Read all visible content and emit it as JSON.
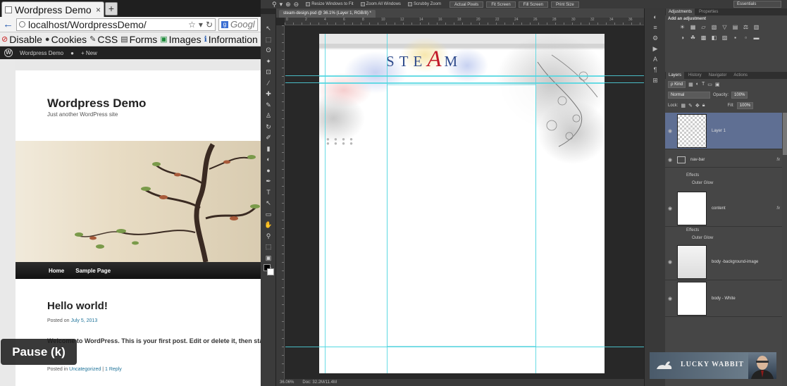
{
  "browser": {
    "tab_title": "Wordpress Demo | J...",
    "tab_close": "×",
    "new_tab": "+",
    "url": "localhost/WordpressDemo/",
    "search_placeholder": "Googl",
    "dev_toolbar": [
      {
        "icon": "disable-icon",
        "glyph": "⊘",
        "color_class": "ic-red",
        "label": "Disable"
      },
      {
        "icon": "cookies-icon",
        "glyph": "●",
        "color_class": "ic-dark",
        "label": "Cookies"
      },
      {
        "icon": "css-icon",
        "glyph": "✎",
        "color_class": "ic-dark",
        "label": "CSS"
      },
      {
        "icon": "forms-icon",
        "glyph": "▤",
        "color_class": "ic-dark",
        "label": "Forms"
      },
      {
        "icon": "images-icon",
        "glyph": "▣",
        "color_class": "ic-green",
        "label": "Images"
      },
      {
        "icon": "information-icon",
        "glyph": "ℹ",
        "color_class": "ic-blue",
        "label": "Information"
      }
    ],
    "admin_bar": {
      "site_name": "Wordpress Demo",
      "new_label": "+ New",
      "wp_letter": "W",
      "comment_glyph": "●"
    }
  },
  "wordpress": {
    "site_title": "Wordpress Demo",
    "tagline": "Just another WordPress site",
    "nav": [
      "Home",
      "Sample Page"
    ],
    "post_title": "Hello world!",
    "posted_on_prefix": "Posted on ",
    "post_date": "July 5, 2013",
    "post_excerpt": "Welcome to WordPress. This is your first post. Edit or delete it, then sta",
    "posted_in_prefix": "Posted in ",
    "category": "Uncategorized",
    "separator": " | ",
    "replies": "1 Reply"
  },
  "overlay": {
    "pause_label": "Pause (k)"
  },
  "photoshop": {
    "options": {
      "tool_glyphs": [
        "⚲",
        "▾",
        "⊕",
        "⊖"
      ],
      "checkboxes": [
        "Resize Windows to Fit",
        "Zoom All Windows",
        "Scrubby Zoom"
      ],
      "buttons": [
        "Actual Pixels",
        "Fit Screen",
        "Fill Screen",
        "Print Size"
      ],
      "workspace": "Essentials"
    },
    "document_tab": "steam-design.psd @ 36.1% (Layer 1, RGB/8) *",
    "ruler_labels": [
      "0",
      "2",
      "4",
      "6",
      "8",
      "10",
      "12",
      "14",
      "16",
      "18",
      "20",
      "22",
      "24",
      "26",
      "28",
      "30",
      "32",
      "34",
      "36"
    ],
    "tools": [
      "↖",
      "⬚",
      "ʘ",
      "✦",
      "⊡",
      "⁄",
      "✚",
      "✎",
      "♙",
      "↻",
      "✐",
      "▮",
      "◐",
      "●",
      "✒",
      "T",
      "↖",
      "▭",
      "✋",
      "⚲",
      "⬚",
      "▣",
      "▢"
    ],
    "logo_text_before": "STE",
    "logo_big_letter": "A",
    "logo_text_after": "M",
    "dots": "● ● ● ●\n● ● ● ●",
    "cursor_glyph": "⚲",
    "status": {
      "zoom": "36.06%",
      "doc_size": "Doc: 32.2M/11.4M"
    },
    "panel_icons": [
      "◐",
      "≡",
      "⚙",
      "▶",
      "A",
      "¶",
      "⊞"
    ],
    "adjustments": {
      "tabs": [
        "Adjustments",
        "Properties"
      ],
      "title": "Add an adjustment",
      "icons": [
        "☀",
        "▦",
        "▱",
        "▧",
        "▽",
        "▤",
        "⚖",
        "▥",
        "◑",
        "☘",
        "▩",
        "◧",
        "▨",
        "▪",
        "▫",
        "▬"
      ]
    },
    "layers": {
      "tabs": [
        "Layers",
        "History",
        "Navigator",
        "Actions"
      ],
      "filter_kind": "ρ Kind",
      "blend_mode": "Normal",
      "opacity_label": "Opacity:",
      "opacity_value": "100%",
      "lock_label": "Lock:",
      "fill_label": "Fill:",
      "fill_value": "100%",
      "eye_glyph": "◉",
      "fx_label": "fx",
      "items": [
        {
          "name": "Layer 1",
          "selected": true
        },
        {
          "name": "nav-bar",
          "fx": true,
          "effects": [
            "Effects",
            "Outer Glow"
          ]
        },
        {
          "name": "content",
          "fx": true,
          "effects": [
            "Effects",
            "Outer Glow"
          ]
        },
        {
          "name": "body -background-image"
        },
        {
          "name": "body - White"
        }
      ]
    },
    "watermark": {
      "text": "LUCKY WABBIT"
    }
  },
  "colors": {
    "accent": "#21759b",
    "steam_blue": "#2e4a8b",
    "steam_red": "#c21a28",
    "guide": "#4fd6e0",
    "ps_selected": "#5f6f93"
  }
}
